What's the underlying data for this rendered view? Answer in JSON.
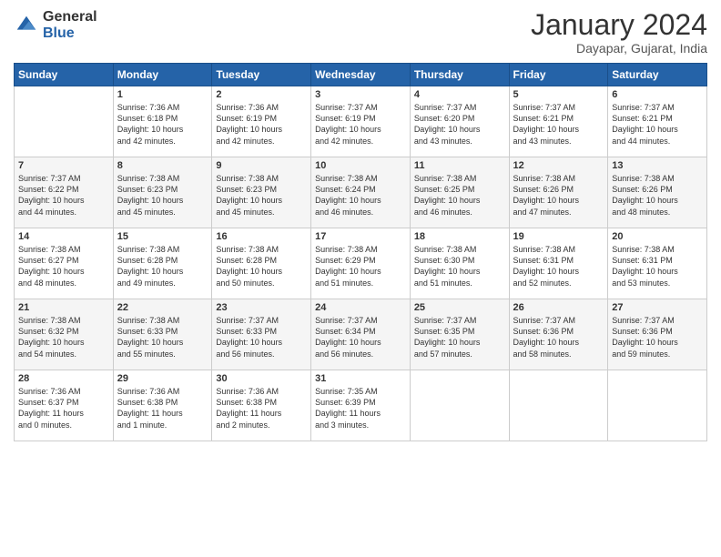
{
  "logo": {
    "general": "General",
    "blue": "Blue"
  },
  "header": {
    "month": "January 2024",
    "location": "Dayapar, Gujarat, India"
  },
  "weekdays": [
    "Sunday",
    "Monday",
    "Tuesday",
    "Wednesday",
    "Thursday",
    "Friday",
    "Saturday"
  ],
  "weeks": [
    [
      {
        "day": "",
        "info": ""
      },
      {
        "day": "1",
        "info": "Sunrise: 7:36 AM\nSunset: 6:18 PM\nDaylight: 10 hours\nand 42 minutes."
      },
      {
        "day": "2",
        "info": "Sunrise: 7:36 AM\nSunset: 6:19 PM\nDaylight: 10 hours\nand 42 minutes."
      },
      {
        "day": "3",
        "info": "Sunrise: 7:37 AM\nSunset: 6:19 PM\nDaylight: 10 hours\nand 42 minutes."
      },
      {
        "day": "4",
        "info": "Sunrise: 7:37 AM\nSunset: 6:20 PM\nDaylight: 10 hours\nand 43 minutes."
      },
      {
        "day": "5",
        "info": "Sunrise: 7:37 AM\nSunset: 6:21 PM\nDaylight: 10 hours\nand 43 minutes."
      },
      {
        "day": "6",
        "info": "Sunrise: 7:37 AM\nSunset: 6:21 PM\nDaylight: 10 hours\nand 44 minutes."
      }
    ],
    [
      {
        "day": "7",
        "info": "Sunrise: 7:37 AM\nSunset: 6:22 PM\nDaylight: 10 hours\nand 44 minutes."
      },
      {
        "day": "8",
        "info": "Sunrise: 7:38 AM\nSunset: 6:23 PM\nDaylight: 10 hours\nand 45 minutes."
      },
      {
        "day": "9",
        "info": "Sunrise: 7:38 AM\nSunset: 6:23 PM\nDaylight: 10 hours\nand 45 minutes."
      },
      {
        "day": "10",
        "info": "Sunrise: 7:38 AM\nSunset: 6:24 PM\nDaylight: 10 hours\nand 46 minutes."
      },
      {
        "day": "11",
        "info": "Sunrise: 7:38 AM\nSunset: 6:25 PM\nDaylight: 10 hours\nand 46 minutes."
      },
      {
        "day": "12",
        "info": "Sunrise: 7:38 AM\nSunset: 6:26 PM\nDaylight: 10 hours\nand 47 minutes."
      },
      {
        "day": "13",
        "info": "Sunrise: 7:38 AM\nSunset: 6:26 PM\nDaylight: 10 hours\nand 48 minutes."
      }
    ],
    [
      {
        "day": "14",
        "info": "Sunrise: 7:38 AM\nSunset: 6:27 PM\nDaylight: 10 hours\nand 48 minutes."
      },
      {
        "day": "15",
        "info": "Sunrise: 7:38 AM\nSunset: 6:28 PM\nDaylight: 10 hours\nand 49 minutes."
      },
      {
        "day": "16",
        "info": "Sunrise: 7:38 AM\nSunset: 6:28 PM\nDaylight: 10 hours\nand 50 minutes."
      },
      {
        "day": "17",
        "info": "Sunrise: 7:38 AM\nSunset: 6:29 PM\nDaylight: 10 hours\nand 51 minutes."
      },
      {
        "day": "18",
        "info": "Sunrise: 7:38 AM\nSunset: 6:30 PM\nDaylight: 10 hours\nand 51 minutes."
      },
      {
        "day": "19",
        "info": "Sunrise: 7:38 AM\nSunset: 6:31 PM\nDaylight: 10 hours\nand 52 minutes."
      },
      {
        "day": "20",
        "info": "Sunrise: 7:38 AM\nSunset: 6:31 PM\nDaylight: 10 hours\nand 53 minutes."
      }
    ],
    [
      {
        "day": "21",
        "info": "Sunrise: 7:38 AM\nSunset: 6:32 PM\nDaylight: 10 hours\nand 54 minutes."
      },
      {
        "day": "22",
        "info": "Sunrise: 7:38 AM\nSunset: 6:33 PM\nDaylight: 10 hours\nand 55 minutes."
      },
      {
        "day": "23",
        "info": "Sunrise: 7:37 AM\nSunset: 6:33 PM\nDaylight: 10 hours\nand 56 minutes."
      },
      {
        "day": "24",
        "info": "Sunrise: 7:37 AM\nSunset: 6:34 PM\nDaylight: 10 hours\nand 56 minutes."
      },
      {
        "day": "25",
        "info": "Sunrise: 7:37 AM\nSunset: 6:35 PM\nDaylight: 10 hours\nand 57 minutes."
      },
      {
        "day": "26",
        "info": "Sunrise: 7:37 AM\nSunset: 6:36 PM\nDaylight: 10 hours\nand 58 minutes."
      },
      {
        "day": "27",
        "info": "Sunrise: 7:37 AM\nSunset: 6:36 PM\nDaylight: 10 hours\nand 59 minutes."
      }
    ],
    [
      {
        "day": "28",
        "info": "Sunrise: 7:36 AM\nSunset: 6:37 PM\nDaylight: 11 hours\nand 0 minutes."
      },
      {
        "day": "29",
        "info": "Sunrise: 7:36 AM\nSunset: 6:38 PM\nDaylight: 11 hours\nand 1 minute."
      },
      {
        "day": "30",
        "info": "Sunrise: 7:36 AM\nSunset: 6:38 PM\nDaylight: 11 hours\nand 2 minutes."
      },
      {
        "day": "31",
        "info": "Sunrise: 7:35 AM\nSunset: 6:39 PM\nDaylight: 11 hours\nand 3 minutes."
      },
      {
        "day": "",
        "info": ""
      },
      {
        "day": "",
        "info": ""
      },
      {
        "day": "",
        "info": ""
      }
    ]
  ]
}
